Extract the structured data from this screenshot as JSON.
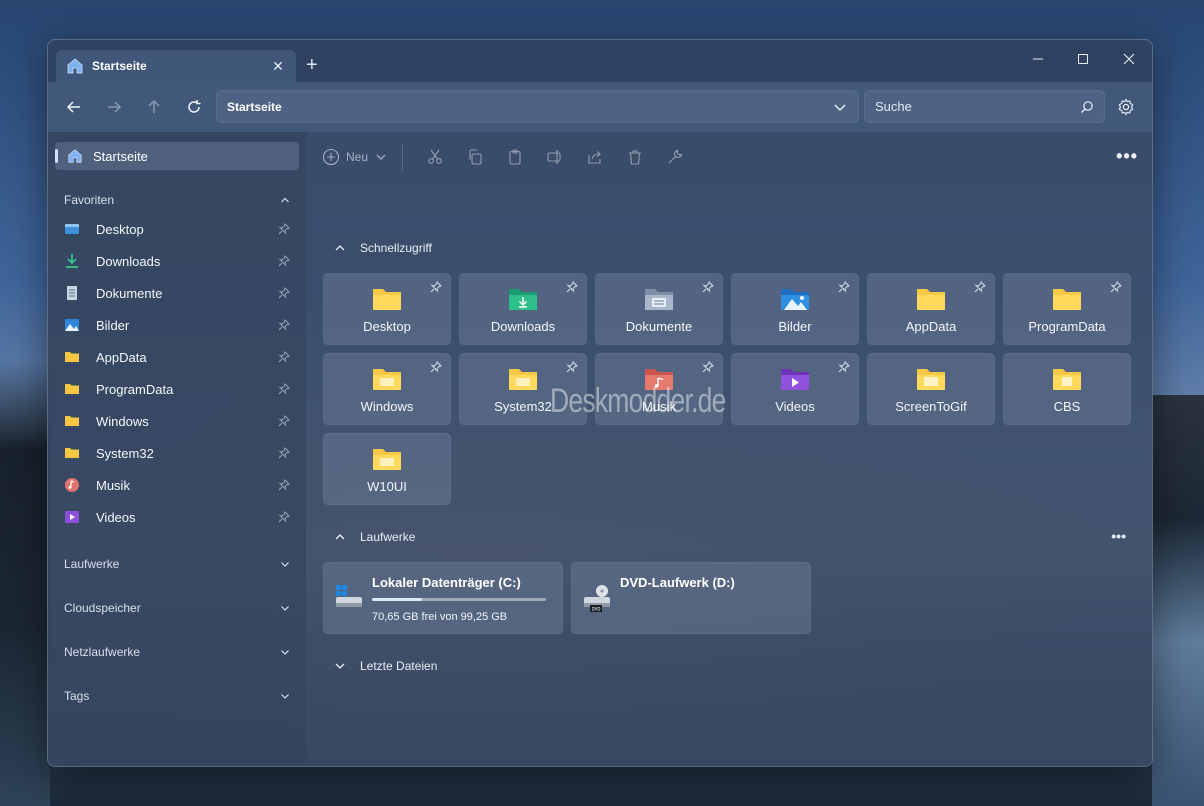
{
  "window": {
    "tab_title": "Startseite",
    "new_tab_symbol": "+",
    "controls": {
      "minimize": "—",
      "maximize": "☐",
      "close": "✕"
    }
  },
  "navbar": {
    "address": "Startseite",
    "search_placeholder": "Suche"
  },
  "sidebar": {
    "home_label": "Startseite",
    "favorites_label": "Favoriten",
    "favorites": [
      {
        "label": "Desktop",
        "icon": "desktop-icon"
      },
      {
        "label": "Downloads",
        "icon": "download-icon"
      },
      {
        "label": "Dokumente",
        "icon": "document-icon"
      },
      {
        "label": "Bilder",
        "icon": "pictures-icon"
      },
      {
        "label": "AppData",
        "icon": "folder-icon"
      },
      {
        "label": "ProgramData",
        "icon": "folder-icon"
      },
      {
        "label": "Windows",
        "icon": "folder-icon"
      },
      {
        "label": "System32",
        "icon": "folder-icon"
      },
      {
        "label": "Musik",
        "icon": "music-icon"
      },
      {
        "label": "Videos",
        "icon": "video-icon"
      }
    ],
    "sections": [
      "Laufwerke",
      "Cloudspeicher",
      "Netzlaufwerke",
      "Tags"
    ]
  },
  "toolbar": {
    "new_label": "Neu",
    "more_symbol": "•••"
  },
  "quick_access": {
    "title": "Schnellzugriff",
    "items": [
      {
        "label": "Desktop",
        "icon": "folder-icon",
        "pinned": true
      },
      {
        "label": "Downloads",
        "icon": "downloads-folder-icon",
        "pinned": true
      },
      {
        "label": "Dokumente",
        "icon": "documents-folder-icon",
        "pinned": true
      },
      {
        "label": "Bilder",
        "icon": "pictures-folder-icon",
        "pinned": true
      },
      {
        "label": "AppData",
        "icon": "folder-icon",
        "pinned": true
      },
      {
        "label": "ProgramData",
        "icon": "folder-icon",
        "pinned": true
      },
      {
        "label": "Windows",
        "icon": "folder-icon",
        "pinned": true
      },
      {
        "label": "System32",
        "icon": "folder-icon",
        "pinned": true
      },
      {
        "label": "Musik",
        "icon": "music-folder-icon",
        "pinned": true
      },
      {
        "label": "Videos",
        "icon": "videos-folder-icon",
        "pinned": true
      },
      {
        "label": "ScreenToGif",
        "icon": "folder-icon",
        "pinned": false
      },
      {
        "label": "CBS",
        "icon": "folder-icon",
        "pinned": false
      },
      {
        "label": "W10UI",
        "icon": "folder-icon",
        "pinned": false
      }
    ]
  },
  "drives": {
    "title": "Laufwerke",
    "more_symbol": "•••",
    "items": [
      {
        "name": "Lokaler Datenträger (C:)",
        "free_text": "70,65 GB frei von 99,25 GB",
        "used_fraction": 0.29,
        "icon": "hard-drive-icon"
      },
      {
        "name": "DVD-Laufwerk (D:)",
        "free_text": "",
        "used_fraction": null,
        "icon": "dvd-drive-icon"
      }
    ]
  },
  "recent": {
    "title": "Letzte Dateien"
  },
  "watermark": "Deskmodder.de",
  "colors": {
    "folder": "#f6c744",
    "accent": "#cfe1ff"
  }
}
